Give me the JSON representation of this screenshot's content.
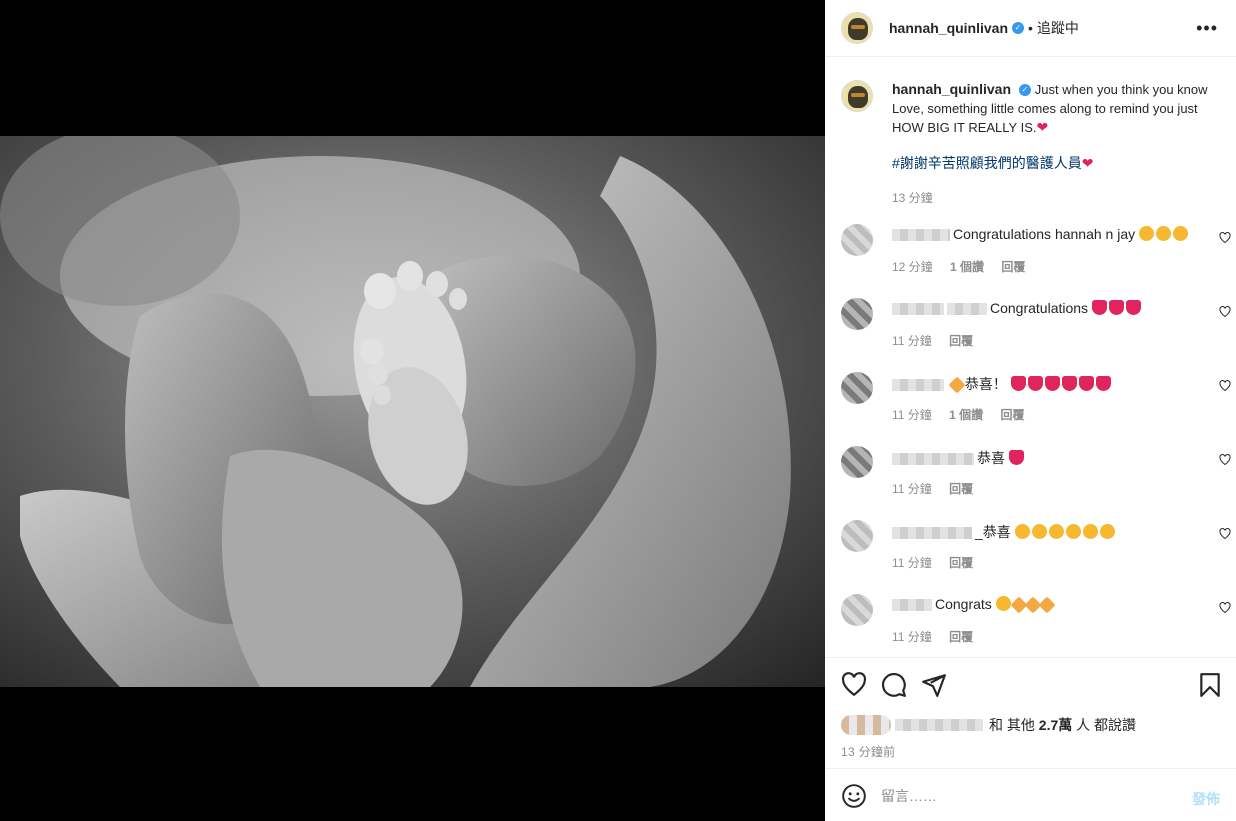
{
  "post": {
    "username": "hannah_quinlivan",
    "follow_state": "追蹤中",
    "separator": "•",
    "caption": "Just when you think you know Love, something little comes along to remind you just HOW BIG IT REALLY IS.",
    "hashtag": "#謝謝辛苦照顧我們的醫護人員",
    "caption_age": "13 分鐘"
  },
  "comments": [
    {
      "text": "Congratulations hannah n jay",
      "age": "12 分鐘",
      "replies": "1 個讚",
      "reply_label": "回覆"
    },
    {
      "text": "Congratulations",
      "age": "11 分鐘",
      "replies": "",
      "reply_label": "回覆"
    },
    {
      "text": "恭喜！",
      "age": "11 分鐘",
      "replies": "1 個讚",
      "reply_label": "回覆"
    },
    {
      "text": "恭喜",
      "age": "11 分鐘",
      "replies": "",
      "reply_label": "回覆"
    },
    {
      "text": "_恭喜",
      "age": "11 分鐘",
      "replies": "",
      "reply_label": "回覆"
    },
    {
      "text": "Congrats",
      "age": "11 分鐘",
      "replies": "",
      "reply_label": "回覆"
    }
  ],
  "likes": {
    "prefix": "和 其他",
    "count": "2.7萬",
    "suffix": "人 都說讚"
  },
  "timestamp": "13 分鐘前",
  "composer": {
    "placeholder": "留言……",
    "post_label": "發佈"
  },
  "colors": {
    "link": "#00376b",
    "verified": "#3897f0",
    "muted": "#8e8e8e",
    "post_button_disabled": "#b2dffc"
  },
  "icons": [
    "more-icon",
    "verified-icon",
    "heart-icon",
    "comment-icon",
    "share-icon",
    "bookmark-icon",
    "smile-icon"
  ]
}
